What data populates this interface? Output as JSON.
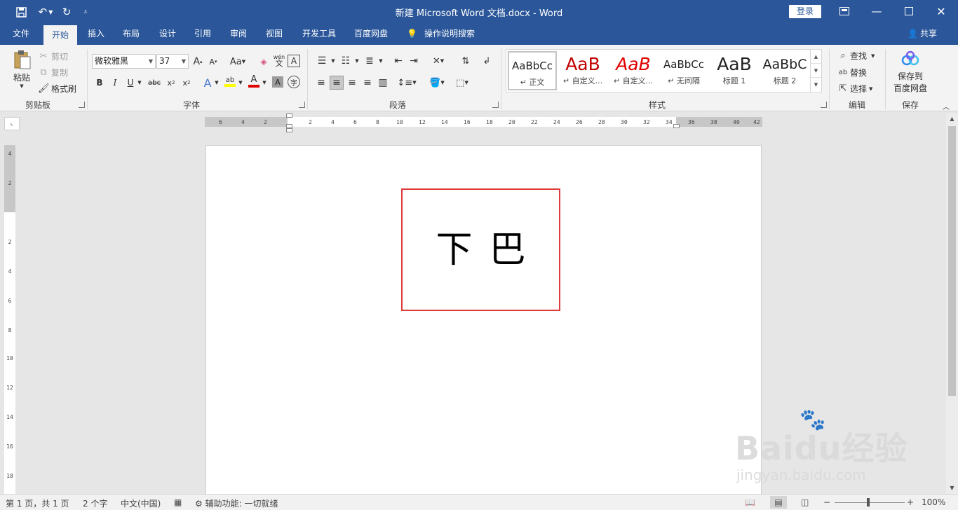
{
  "window": {
    "title": "新建 Microsoft Word 文档.docx  -  Word",
    "login_label": "登录"
  },
  "tabs": [
    {
      "label": "文件"
    },
    {
      "label": "开始",
      "active": true
    },
    {
      "label": "插入"
    },
    {
      "label": "布局"
    },
    {
      "label": "设计"
    },
    {
      "label": "引用"
    },
    {
      "label": "审阅"
    },
    {
      "label": "视图"
    },
    {
      "label": "开发工具"
    },
    {
      "label": "百度网盘"
    }
  ],
  "tell_me": "操作说明搜索",
  "share_label": "共享",
  "clipboard": {
    "paste": "粘贴",
    "cut": "剪切",
    "copy": "复制",
    "format_painter": "格式刷",
    "group": "剪贴板"
  },
  "font": {
    "name": "微软雅黑",
    "size": "37",
    "group": "字体"
  },
  "paragraph": {
    "group": "段落"
  },
  "styles": {
    "group": "样式",
    "items": [
      {
        "preview": "AaBbCc",
        "name": "正文",
        "color": "#000000"
      },
      {
        "preview": "AaB",
        "name": "自定义...",
        "color": "#c00000"
      },
      {
        "preview": "AaB",
        "name": "自定义...",
        "color": "#e00000"
      },
      {
        "preview": "AaBbCc",
        "name": "无间隔",
        "color": "#000000"
      },
      {
        "preview": "AaB",
        "name": "标题 1",
        "color": "#000000"
      },
      {
        "preview": "AaBbC",
        "name": "标题 2",
        "color": "#000000"
      }
    ]
  },
  "editing": {
    "find": "查找",
    "replace": "替换",
    "select": "选择",
    "group": "编辑"
  },
  "save_group": {
    "button_line1": "保存到",
    "button_line2": "百度网盘",
    "group": "保存"
  },
  "ruler": {
    "h_left": [
      "6",
      "4",
      "2"
    ],
    "h_right": [
      "2",
      "4",
      "6",
      "8",
      "10",
      "12",
      "14",
      "16",
      "18",
      "20",
      "22",
      "24",
      "26",
      "28",
      "30",
      "32",
      "34",
      "36",
      "38",
      "40",
      "42"
    ],
    "v_top": [
      "4",
      "2"
    ],
    "v_bottom": [
      "2",
      "4",
      "6",
      "8",
      "10",
      "12",
      "14",
      "16",
      "18"
    ]
  },
  "document": {
    "textbox_text": "下巴"
  },
  "watermark": {
    "logo": "Baidu经验",
    "url": "jingyan.baidu.com"
  },
  "status": {
    "page": "第 1 页，共 1 页",
    "words": "2 个字",
    "language": "中文(中国)",
    "accessibility": "辅助功能: 一切就绪",
    "zoom": "100%"
  }
}
